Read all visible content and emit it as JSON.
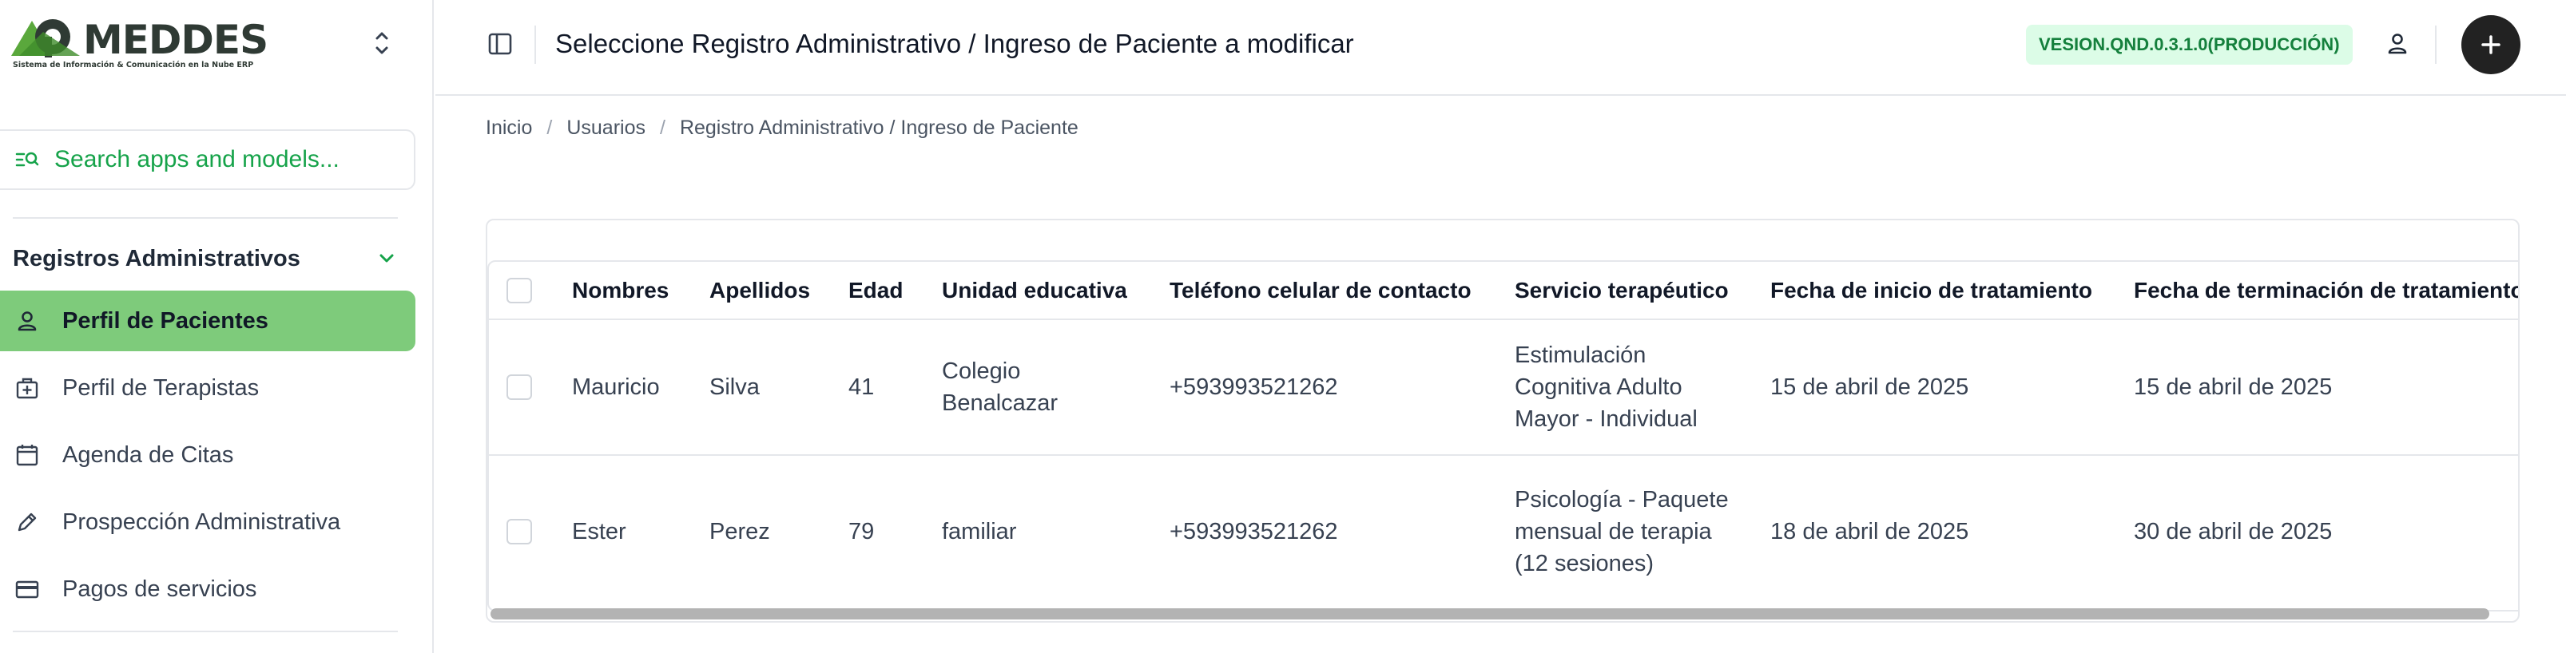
{
  "brand": {
    "name": "MEDDES",
    "tagline": "Sistema de Información & Comunicación en la Nube ERP"
  },
  "search": {
    "placeholder": "Search apps and models..."
  },
  "sidebar": {
    "group_title": "Registros Administrativos",
    "items": [
      {
        "label": "Perfil de Pacientes",
        "icon": "person-icon",
        "active": true
      },
      {
        "label": "Perfil de Terapistas",
        "icon": "medical-bag-icon",
        "active": false
      },
      {
        "label": "Agenda de Citas",
        "icon": "calendar-icon",
        "active": false
      },
      {
        "label": "Prospección Administrativa",
        "icon": "pencil-icon",
        "active": false
      },
      {
        "label": "Pagos de servicios",
        "icon": "credit-card-icon",
        "active": false
      }
    ]
  },
  "header": {
    "title": "Seleccione Registro Administrativo / Ingreso de Paciente a modificar",
    "version": "VESION.QND.0.3.1.0(PRODUCCIÓN)"
  },
  "breadcrumb": [
    "Inicio",
    "Usuarios",
    "Registro Administrativo / Ingreso de Paciente"
  ],
  "table": {
    "columns": [
      "Nombres",
      "Apellidos",
      "Edad",
      "Unidad educativa",
      "Teléfono celular de contacto",
      "Servicio terapéutico",
      "Fecha de inicio de tratamiento",
      "Fecha de terminación de tratamiento"
    ],
    "rows": [
      [
        "Mauricio",
        "Silva",
        "41",
        "Colegio Benalcazar",
        "+593993521262",
        "Estimulación Cognitiva Adulto Mayor - Individual",
        "15 de abril de 2025",
        "15 de abril de 2025"
      ],
      [
        "Ester",
        "Perez",
        "79",
        "familiar",
        "+593993521262",
        "Psicología - Paquete mensual de terapia (12 sesiones)",
        "18 de abril de 2025",
        "30 de abril de 2025"
      ]
    ]
  },
  "colors": {
    "accent": "#7ecb7b",
    "search_text": "#16a34a",
    "version_bg": "#dcfce7",
    "version_text": "#15803d"
  }
}
